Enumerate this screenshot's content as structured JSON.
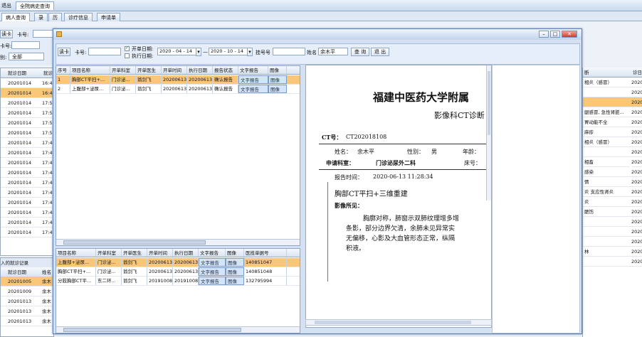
{
  "topbar": {
    "left_text": "退出",
    "title_tab": "全院病史查询"
  },
  "tabs": [
    "病人查询",
    "录",
    "历",
    "诊疗信息",
    "申请单"
  ],
  "bg_filter": {
    "card_label": "读卡",
    "card_no_label": "卡号:",
    "label2": "卡号:",
    "label3": "别:",
    "all_option": "全部"
  },
  "bg_left": {
    "col1": "就诊日期",
    "col2": "就诊",
    "rows": [
      "20201014",
      "20201014",
      "20201014",
      "20201014",
      "20201014",
      "20201014",
      "20201014",
      "20201014",
      "20201014",
      "20201014",
      "20201014",
      "20201014",
      "20201014",
      "20201014",
      "20201014",
      "20201014"
    ],
    "times": [
      "16:4",
      "16:4",
      "17:5",
      "17:5",
      "17:5",
      "17:5",
      "17:4",
      "17:4",
      "17:4",
      "17:4",
      "17:4",
      "17:4",
      "17:4",
      "17:4",
      "17:4",
      "17:4"
    ]
  },
  "bg_left2": {
    "title": "入的就诊记录",
    "col1": "就诊日期",
    "col2": "姓名",
    "rows": [
      [
        "20201005",
        "余木"
      ],
      [
        "20201009",
        "余木"
      ],
      [
        "20201013",
        "余木"
      ],
      [
        "20201013",
        "余木"
      ],
      [
        "20201013",
        "余木"
      ]
    ]
  },
  "bg_right": {
    "col1": "断",
    "col2": "诊日",
    "rows": [
      [
        "相炎（感冒）",
        "2020"
      ],
      [
        "",
        "2020"
      ],
      [
        "",
        "2020"
      ],
      [
        "龈感冒, 急性肾脏...",
        "2020"
      ],
      [
        "胃动能不全",
        "2020"
      ],
      [
        "麻疹",
        "2020"
      ],
      [
        "相炎（感冒）",
        "2020"
      ],
      [
        "",
        "2020"
      ],
      [
        "相畜",
        "2020"
      ],
      [
        "感染",
        "2020"
      ],
      [
        "情",
        "2020"
      ],
      [
        "炎 支应性肾炎",
        "2020"
      ],
      [
        "炎",
        "2020"
      ],
      [
        "腮饬",
        "2020"
      ],
      [
        "",
        "2020"
      ],
      [
        "",
        "2020"
      ],
      [
        "",
        "2020"
      ],
      [
        "林",
        "2020"
      ],
      [
        "",
        "2020"
      ]
    ]
  },
  "window": {
    "toolbar": {
      "card_btn": "读卡",
      "card_no_label": "卡号:",
      "card_no_value": "",
      "start_date_label": "开单日期:",
      "exec_date_label": "执行日期:",
      "date_from": "2020 - 04 - 14",
      "date_sep": "—",
      "date_to": "2020 - 10 - 14",
      "reg_no_label": "挂号号",
      "reg_no_value": "",
      "name_label": "姓名",
      "name_value": "余木平",
      "query_btn": "查 询",
      "exit_btn": "退 出"
    },
    "grid1": {
      "headers": [
        "序号",
        "项目名称",
        "开单科室",
        "开单医生",
        "开单时间",
        "执行日期",
        "报告状态",
        "文字报告",
        "图像"
      ],
      "rows": [
        [
          "1",
          "胸部CT平扫+...",
          "门诊泌...",
          "翁剑飞",
          "20200613",
          "20200613",
          "确认报告",
          "文字报告",
          "图像"
        ],
        [
          "2",
          "上腹部+泌尿...",
          "门诊泌...",
          "翁剑飞",
          "20200613",
          "20200613",
          "确认报告",
          "文字报告",
          "图像"
        ]
      ]
    },
    "grid2": {
      "headers": [
        "项目名称",
        "开单科室",
        "开单医生",
        "开单时间",
        "执行日期",
        "文字报告",
        "图像",
        "医技单据号"
      ],
      "rows": [
        [
          "上腹部+泌尿...",
          "门诊泌...",
          "翁剑飞",
          "20200613",
          "20200613",
          "文字报告",
          "图像",
          "140851047"
        ],
        [
          "胸部CT平扫+...",
          "门诊泌...",
          "翁剑飞",
          "20200613",
          "20200613",
          "文字报告",
          "图像",
          "140851048"
        ],
        [
          "分肢胸部CT平...",
          "东二环...",
          "翁剑飞",
          "20191008",
          "20191008",
          "文字报告",
          "图像",
          "132795994"
        ]
      ]
    },
    "report": {
      "hospital": "福建中医药大学附属",
      "dept_title": "影像科CT诊断",
      "ct_no_label": "CT号：",
      "ct_no": "CT202018108",
      "name_label": "姓名：",
      "name": "余木平",
      "gender_label": "性别：",
      "gender": "男",
      "age_label": "年龄：",
      "dept_label": "申请科室：",
      "dept": "门诊泌尿外二科",
      "bed_label": "床号：",
      "time_label": "报告时间：",
      "time": "2020-06-13 11:28:34",
      "exam": "胸部CT平扫+三维重建",
      "finding_label": "影像所见：",
      "f1": "胸廓对称，肺窗示双肺纹理增多增",
      "f2": "条影，部分边界欠清，余肺未见异常实",
      "f3": "无偏移，心影及大血管形态正常，纵隔",
      "f4": "积液。"
    }
  }
}
